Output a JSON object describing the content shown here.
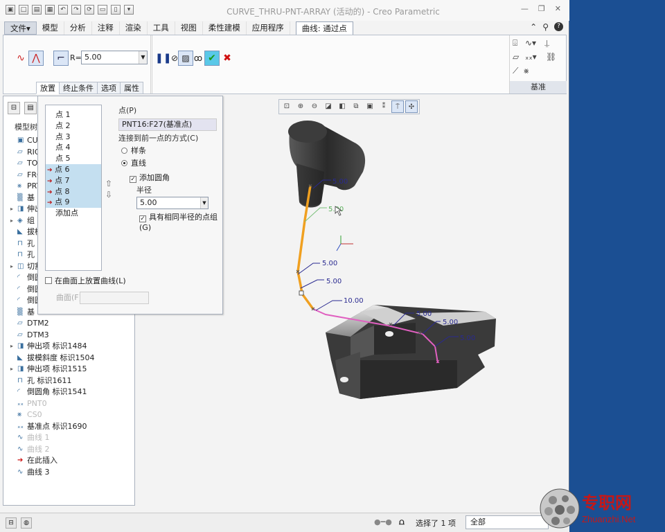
{
  "window": {
    "title": "CURVE_THRU-PNT-ARRAY (活动的) - Creo Parametric"
  },
  "menu_tabs": [
    {
      "label": "文件",
      "caret": "▾"
    },
    {
      "label": "模型"
    },
    {
      "label": "分析"
    },
    {
      "label": "注释"
    },
    {
      "label": "渲染"
    },
    {
      "label": "工具"
    },
    {
      "label": "视图"
    },
    {
      "label": "柔性建模"
    },
    {
      "label": "应用程序"
    },
    {
      "label": "曲线: 通过点"
    }
  ],
  "ribbon": {
    "radius_label": "R=",
    "radius_value": "5.00",
    "datum_label": "基准"
  },
  "feature_tabs": [
    "放置",
    "终止条件",
    "选项",
    "属性"
  ],
  "placement": {
    "points": [
      "点 1",
      "点 2",
      "点 3",
      "点 4",
      "点 5",
      "点 6",
      "点 7",
      "点 8",
      "点 9"
    ],
    "add_point": "添加点",
    "point_label": "点(P)",
    "point_value": "PNT16:F27(基准点)",
    "connect_label": "连接到前一点的方式(C)",
    "radio_spline": "样条",
    "radio_line": "直线",
    "add_fillet": "添加圆角",
    "radius_label": "半径",
    "radius_value": "5.00",
    "same_radius": "具有相同半径的点组(G)",
    "place_on_surface": "在曲面上放置曲线(L)",
    "surface_label": "曲面(F)"
  },
  "model_tree": {
    "header": "模型树",
    "items": [
      {
        "label": "CURVE",
        "icon": "part"
      },
      {
        "label": "RIG",
        "icon": "plane"
      },
      {
        "label": "TO",
        "icon": "plane"
      },
      {
        "label": "FRO",
        "icon": "plane"
      },
      {
        "label": "PRT",
        "icon": "csys"
      },
      {
        "label": "基",
        "icon": "dim"
      },
      {
        "label": "伸出",
        "icon": "extrude",
        "exp": "▸"
      },
      {
        "label": "组",
        "icon": "group",
        "exp": "▸"
      },
      {
        "label": "拔模",
        "icon": "draft"
      },
      {
        "label": "孔",
        "icon": "hole"
      },
      {
        "label": "孔",
        "icon": "hole"
      },
      {
        "label": "切割",
        "icon": "cut",
        "exp": "▸"
      },
      {
        "label": "倒圆",
        "icon": "round"
      },
      {
        "label": "倒圆",
        "icon": "round"
      },
      {
        "label": "倒圆",
        "icon": "round"
      },
      {
        "label": "基",
        "icon": "dim"
      },
      {
        "label": "DTM2",
        "icon": "plane"
      },
      {
        "label": "DTM3",
        "icon": "plane"
      },
      {
        "label": "伸出项 标识1484",
        "icon": "extrude",
        "exp": "▸"
      },
      {
        "label": "拔模斜度 标识1504",
        "icon": "draft"
      },
      {
        "label": "伸出项 标识1515",
        "icon": "extrude",
        "exp": "▸"
      },
      {
        "label": "孔 标识1611",
        "icon": "hole"
      },
      {
        "label": "倒圆角 标识1541",
        "icon": "round"
      },
      {
        "label": "PNT0",
        "icon": "point",
        "dim": true
      },
      {
        "label": "CS0",
        "icon": "csys",
        "dim": true
      },
      {
        "label": "基准点 标识1690",
        "icon": "point"
      },
      {
        "label": "曲线 1",
        "icon": "curve",
        "dim": true
      },
      {
        "label": "曲线 2",
        "icon": "curve",
        "dim": true
      },
      {
        "label": "在此插入",
        "icon": "insert",
        "red": true
      },
      {
        "label": "曲线 3",
        "icon": "curve"
      }
    ]
  },
  "dimensions": {
    "d1": "5.00",
    "d2": "5.00",
    "d3": "5.00",
    "d4": "5.00",
    "d5": "10.00",
    "d6": "5.00",
    "d7": "5.00",
    "d8": "5.00"
  },
  "status": {
    "selection_info": "选择了 1 项",
    "filter_value": "全部"
  },
  "watermark": {
    "cn": "专职网",
    "en": "Zhuanzhi.Net"
  },
  "colors": {
    "accent": "#1b4f93",
    "curve_orange": "#f0a020",
    "curve_pink": "#e060c0",
    "selected_list": "#c4dff0"
  }
}
